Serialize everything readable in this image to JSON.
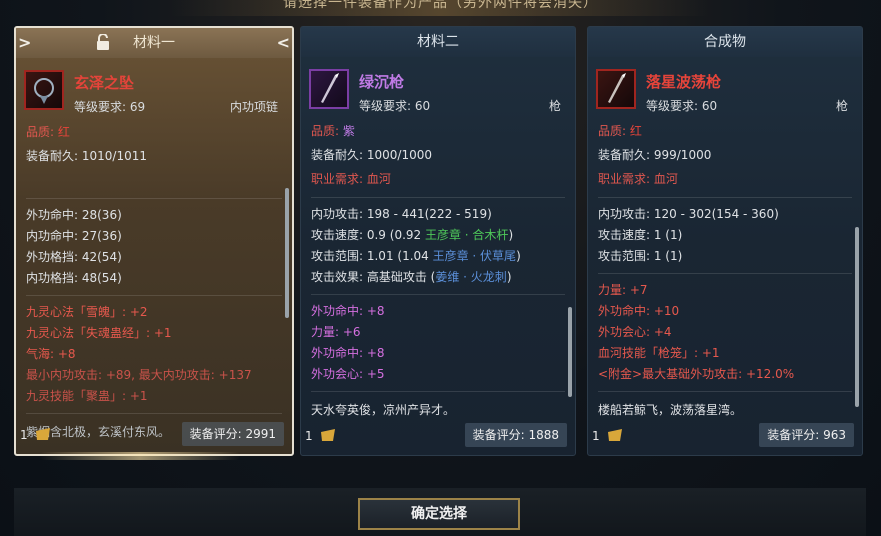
{
  "header": {
    "caption": "请选择一件装备作为产品（另外两件将会消失）"
  },
  "panels": [
    {
      "title": "材料一",
      "item": {
        "name": "玄泽之坠",
        "level": "等级要求: 69",
        "type": "内功项链"
      },
      "quality_label": "品质:",
      "quality_value": "红",
      "durability": "装备耐久: 1010/1011",
      "stats": [
        "外功命中: 28(36)",
        "内功命中: 27(36)",
        "外功格挡: 42(54)",
        "内功格挡: 48(54)"
      ],
      "bonuses": [
        "九灵心法「雪魄」: +2",
        "九灵心法「失魂蛊经」: +1",
        "气海: +8",
        "最小内功攻击: +89, 最大内功攻击: +137",
        "九灵技能「聚蛊」: +1"
      ],
      "flavor": "紫烟含北极，玄溪付东风。",
      "bag_count": "1",
      "score_label": "装备评分:",
      "score": "2991"
    },
    {
      "title": "材料二",
      "item": {
        "name": "绿沉枪",
        "level": "等级要求: 60",
        "type": "枪"
      },
      "quality_label": "品质:",
      "quality_value": "紫",
      "durability": "装备耐久: 1000/1000",
      "class_label": "职业需求:",
      "class_value": "血河",
      "attack": "内功攻击: 198 - 441(222 - 519)",
      "speed_prefix": "攻击速度: 0.9 (0.92 ",
      "speed_set": "王彦章 · 合木杆",
      "speed_suffix": ")",
      "range_prefix": "攻击范围: 1.01 (1.04 ",
      "range_set": "王彦章 · 伏草尾",
      "range_suffix": ")",
      "effect_prefix": "攻击效果: 高基础攻击 (",
      "effect_set": "姜维 · 火龙刺",
      "effect_suffix": ")",
      "bonuses": [
        "外功命中: +8",
        "力量: +6",
        "外功命中: +8",
        "外功会心: +5"
      ],
      "flavor": "天水夸英俊，凉州产异才。",
      "bag_count": "1",
      "score_label": "装备评分:",
      "score": "1888"
    },
    {
      "title": "合成物",
      "item": {
        "name": "落星波荡枪",
        "level": "等级要求: 60",
        "type": "枪"
      },
      "quality_label": "品质:",
      "quality_value": "红",
      "durability": "装备耐久: 999/1000",
      "class_label": "职业需求:",
      "class_value": "血河",
      "attack": "内功攻击: 120 - 302(154 - 360)",
      "speed": "攻击速度: 1 (1)",
      "range": "攻击范围: 1 (1)",
      "bonuses": [
        "力量: +7",
        "外功命中: +10",
        "外功会心: +4",
        "血河技能「枪笼」: +1",
        "<附金>最大基础外功攻击: +12.0%"
      ],
      "flavor": "楼船若鲸飞，波荡落星湾。",
      "bag_count": "1",
      "score_label": "装备评分:",
      "score": "963"
    }
  ],
  "confirm_button": "确定选择",
  "colors": {
    "red_quality": "#e6443a",
    "purple_quality": "#c07be6",
    "set_green": "#4fc95a",
    "set_blue": "#5b8fd8",
    "gold_border": "#9c8348"
  }
}
